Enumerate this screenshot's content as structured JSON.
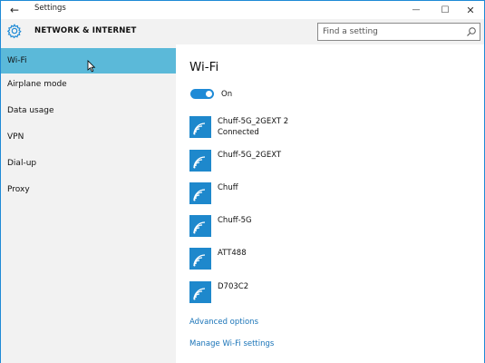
{
  "window": {
    "title": "Settings",
    "back_glyph": "←",
    "minimize_glyph": "—",
    "maximize_glyph": "☐",
    "close_glyph": "✕"
  },
  "header": {
    "title": "NETWORK & INTERNET",
    "icon": "gear-icon",
    "search_placeholder": "Find a setting"
  },
  "sidebar": {
    "items": [
      {
        "label": "Wi-Fi",
        "active": true
      },
      {
        "label": "Airplane mode",
        "active": false
      },
      {
        "label": "Data usage",
        "active": false
      },
      {
        "label": "VPN",
        "active": false
      },
      {
        "label": "Dial-up",
        "active": false
      },
      {
        "label": "Proxy",
        "active": false
      }
    ]
  },
  "main": {
    "title": "Wi-Fi",
    "toggle": {
      "state": "On",
      "on": true
    },
    "networks": [
      {
        "name": "Chuff-5G_2GEXT 2",
        "status": "Connected"
      },
      {
        "name": "Chuff-5G_2GEXT",
        "status": ""
      },
      {
        "name": "Chuff",
        "status": ""
      },
      {
        "name": "Chuff-5G",
        "status": ""
      },
      {
        "name": "ATT488",
        "status": ""
      },
      {
        "name": "D703C2",
        "status": ""
      }
    ],
    "links": {
      "advanced": "Advanced options",
      "manage": "Manage Wi-Fi settings"
    }
  },
  "colors": {
    "accent": "#1e8ad6",
    "sidebar_active": "#5bb9d9",
    "link": "#1a74b8",
    "wifi_tile": "#1e88cc"
  }
}
